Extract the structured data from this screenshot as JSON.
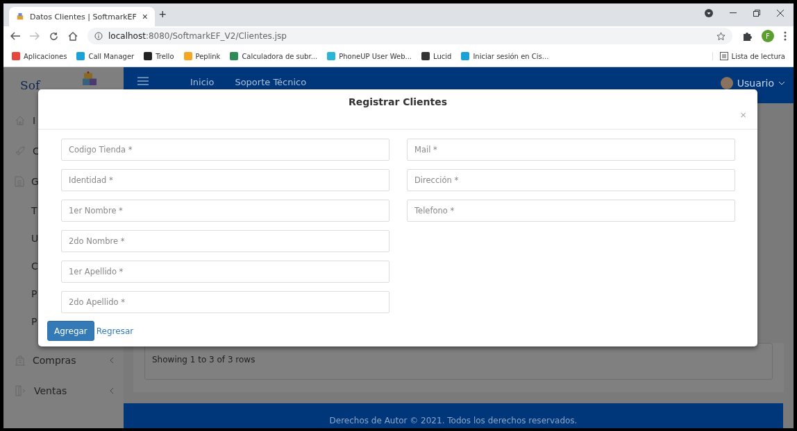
{
  "browser": {
    "tab_title": "Datos Clientes | SoftmarkEF",
    "tab_close": "×",
    "new_tab": "+",
    "url_host": "localhost",
    "url_rest": ":8080/SoftmarkEF_V2/Clientes.jsp",
    "profile": "F",
    "bookmarks": [
      {
        "label": "Aplicaciones",
        "color": "#e8453c"
      },
      {
        "label": "Call Manager",
        "color": "#1ba0d7"
      },
      {
        "label": "Trello",
        "color": "#222222"
      },
      {
        "label": "Peplink",
        "color": "#f5a623"
      },
      {
        "label": "Calculadora de subr...",
        "color": "#2e8b57"
      },
      {
        "label": "PhoneUP User Web...",
        "color": "#29b6d6"
      },
      {
        "label": "Lucid",
        "color": "#333333"
      },
      {
        "label": "Iniciar sesión en Cis...",
        "color": "#1ba0d7"
      }
    ],
    "reading_list": "Lista de lectura"
  },
  "page": {
    "logo": "Sof",
    "nav": [
      "Inicio",
      "Soporte Técnico"
    ],
    "user": "Usuario",
    "sidebar": [
      {
        "label": "I",
        "kind": "section",
        "collapsible": false
      },
      {
        "label": "C",
        "kind": "section",
        "collapsible": false
      },
      {
        "label": "G",
        "kind": "section",
        "collapsible": false
      },
      {
        "label": "T",
        "kind": "subitem",
        "collapsible": false
      },
      {
        "label": "U",
        "kind": "subitem",
        "collapsible": false
      },
      {
        "label": "C",
        "kind": "subitem",
        "collapsible": false
      },
      {
        "label": "P",
        "kind": "subitem",
        "collapsible": false
      },
      {
        "label": "P",
        "kind": "subitem",
        "collapsible": false
      },
      {
        "label": "Compras",
        "kind": "section",
        "collapsible": true
      },
      {
        "label": "Ventas",
        "kind": "section",
        "collapsible": true
      }
    ],
    "table_info": "Showing 1 to 3 of 3 rows",
    "footer": "Derechos de Autor © 2021. Todos los derechos reservados."
  },
  "modal": {
    "title": "Registrar Clientes",
    "close": "×",
    "left_fields": [
      {
        "placeholder": "Codigo Tienda *"
      },
      {
        "placeholder": "Identidad *"
      },
      {
        "placeholder": "1er Nombre *"
      },
      {
        "placeholder": "2do Nombre *"
      },
      {
        "placeholder": "1er Apellido *"
      },
      {
        "placeholder": "2do Apellido *"
      }
    ],
    "right_fields": [
      {
        "placeholder": "Mail *"
      },
      {
        "placeholder": "Dirección *"
      },
      {
        "placeholder": "Telefono *"
      }
    ],
    "primary_button": "Agregar",
    "link": "Regresar"
  }
}
